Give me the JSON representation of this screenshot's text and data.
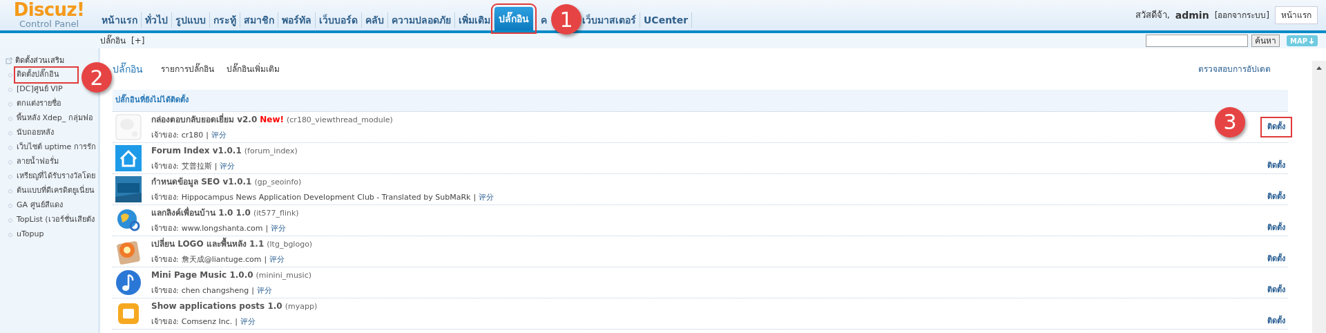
{
  "header": {
    "logo": {
      "title": "Discuz!",
      "subtitle": "Control Panel"
    },
    "nav": [
      {
        "label": "หน้าแรก",
        "selected": false
      },
      {
        "label": "ทั่วไป",
        "selected": false
      },
      {
        "label": "รูปแบบ",
        "selected": false
      },
      {
        "label": "กระทู้",
        "selected": false
      },
      {
        "label": "สมาชิก",
        "selected": false
      },
      {
        "label": "พอร์ทัล",
        "selected": false
      },
      {
        "label": "เว็บบอร์ด",
        "selected": false
      },
      {
        "label": "คลับ",
        "selected": false
      },
      {
        "label": "ความปลอดภัย",
        "selected": false
      },
      {
        "label": "เพิ่มเติม",
        "selected": false
      },
      {
        "label": "ปลั๊กอิน",
        "selected": true,
        "callout": "1"
      },
      {
        "label": "ค",
        "selected": false
      },
      {
        "label": "เว็บมาสเตอร์",
        "selected": false
      },
      {
        "label": "UCenter",
        "selected": false
      }
    ],
    "greeting": "สวัสดีจ้า,",
    "username": "admin",
    "logout": "[ออกจากระบบ]",
    "home_button": "หน้าแรก"
  },
  "subbar": {
    "breadcrumb": "ปลั๊กอิน",
    "add": "[+]",
    "search_button": "ค้นหา",
    "map_button": "MAP"
  },
  "sidebar": {
    "heading": "ติดตั้งส่วนเสริม",
    "items": [
      {
        "label": "ติดตั้งปลั๊กอิน",
        "callout": "2"
      },
      {
        "label": "[DC]ศูนย์ VIP"
      },
      {
        "label": "ตกแต่งรายชื่อ"
      },
      {
        "label": "พื้นหลัง Xdep_ กลุ่มฟอ"
      },
      {
        "label": "นับถอยหลัง"
      },
      {
        "label": "เว็บไซต์ uptime การรัก"
      },
      {
        "label": "ลายน้ำฟอรั่ม"
      },
      {
        "label": "เหรียญที่ได้รับรางวัลโดย"
      },
      {
        "label": "ต้นแบบที่ดีเครดิตยูเนี่ยน"
      },
      {
        "label": "GA ศูนย์สีแดง"
      },
      {
        "label": "TopList (เวอร์ชั่นเสียตัง"
      },
      {
        "label": "uTopup"
      }
    ]
  },
  "main": {
    "tabs": [
      {
        "label": "ปลั๊กอิน",
        "selected": true
      },
      {
        "label": "รายการปลั๊กอิน",
        "selected": false
      },
      {
        "label": "ปลั๊กอินเพิ่มเติม",
        "selected": false
      }
    ],
    "check_updates": "ตรวจสอบการอัปเดต",
    "section_title": "ปลั๊กอินที่ยังไม่ได้ติดตั้ง",
    "plugins": [
      {
        "kind": "blank",
        "name": "กล่องตอบกลับยอดเยี่ยม v2.0",
        "badge": "New!",
        "id": "(cr180_viewthread_module)",
        "owner_label": "เจ้าของ:",
        "owner": "cr180",
        "separator": "|",
        "rate": "评分",
        "install": "ติดตั้ง",
        "callout": "3"
      },
      {
        "kind": "house",
        "name": "Forum Index v1.0.1",
        "id": "(forum_index)",
        "owner_label": "เจ้าของ:",
        "owner": "艾普拉斯",
        "separator": "|",
        "rate": "评分",
        "install": "ติดตั้ง"
      },
      {
        "kind": "seo",
        "name": "กำหนดข้อมูล SEO v1.0.1",
        "id": "(gp_seoinfo)",
        "owner_label": "เจ้าของ:",
        "owner": "Hippocampus News Application Development Club - Translated by SubMaRk",
        "separator": "|",
        "rate": "评分",
        "install": "ติดตั้ง"
      },
      {
        "kind": "globe",
        "name": "แลกลิงค์เพื่อนบ้าน 1.0 1.0",
        "id": "(it577_flink)",
        "owner_label": "เจ้าของ:",
        "owner": "www.longshanta.com",
        "separator": "|",
        "rate": "评分",
        "install": "ติดตั้ง"
      },
      {
        "kind": "flower",
        "name": "เปลี่ยน LOGO และพื้นหลัง 1.1",
        "id": "(ltg_bglogo)",
        "owner_label": "เจ้าของ:",
        "owner": "詹天成@liantuge.com",
        "separator": "|",
        "rate": "评分",
        "install": "ติดตั้ง"
      },
      {
        "kind": "note",
        "name": "Mini Page Music 1.0.0",
        "id": "(minini_music)",
        "owner_label": "เจ้าของ:",
        "owner": "chen changsheng",
        "separator": "|",
        "rate": "评分",
        "install": "ติดตั้ง"
      },
      {
        "kind": "app",
        "name": "Show applications posts 1.0",
        "id": "(myapp)",
        "owner_label": "เจ้าของ:",
        "owner": "Comsenz Inc.",
        "separator": "|",
        "rate": "评分",
        "install": "ติดตั้ง"
      }
    ]
  }
}
